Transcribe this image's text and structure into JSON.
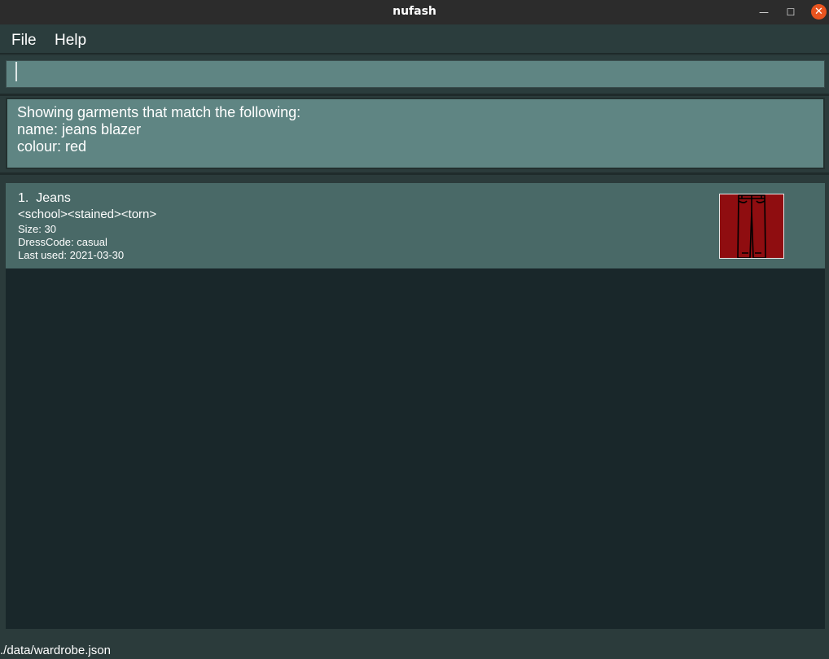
{
  "window": {
    "title": "nufash",
    "minimize_glyph": "—",
    "maximize_glyph": "☐",
    "close_glyph": "✕"
  },
  "menu": {
    "items": [
      "File",
      "Help"
    ]
  },
  "command_box": {
    "value": ""
  },
  "result_display": {
    "lines": [
      "Showing garments that match the following:",
      "name: jeans blazer",
      "colour: red"
    ]
  },
  "garments": [
    {
      "index": "1.",
      "name": "Jeans",
      "tags": "<school><stained><torn>",
      "size": "Size: 30",
      "dress_code": "DressCode: casual",
      "last_used": "Last used: 2021-03-30",
      "icon": "jeans-icon",
      "colour": "#8f0d10"
    }
  ],
  "status_bar": {
    "path": "./data/wardrobe.json"
  }
}
